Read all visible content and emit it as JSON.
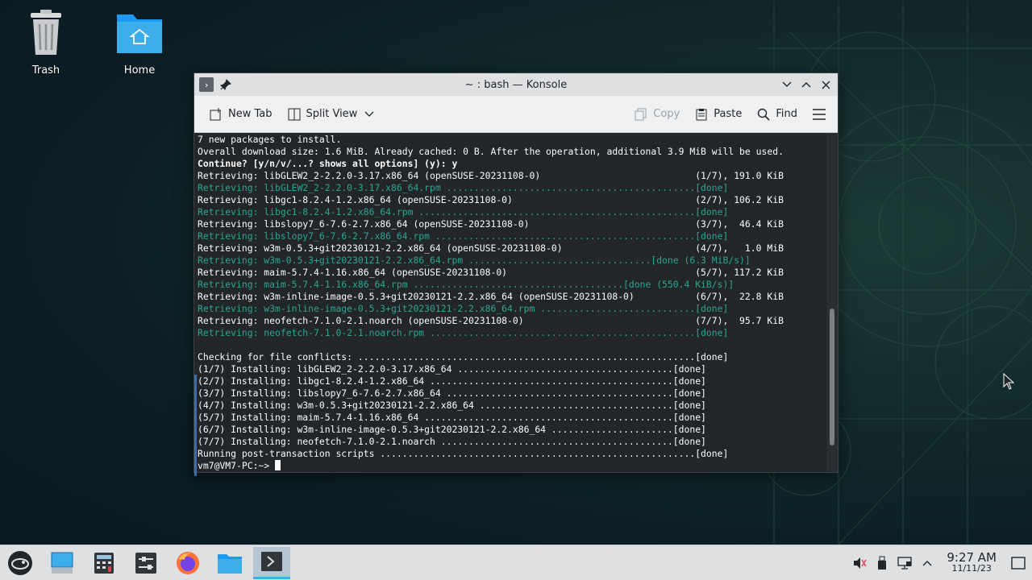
{
  "desktop": {
    "icons": [
      {
        "label": "Trash",
        "icon": "trash-icon"
      },
      {
        "label": "Home",
        "icon": "home-folder-icon"
      }
    ]
  },
  "window": {
    "title": "~ : bash — Konsole",
    "toolbar": {
      "new_tab": "New Tab",
      "split_view": "Split View",
      "copy": "Copy",
      "paste": "Paste",
      "find": "Find"
    }
  },
  "terminal": {
    "lines": [
      {
        "text": "7 new packages to install.",
        "style": "normal"
      },
      {
        "text": "Overall download size: 1.6 MiB. Already cached: 0 B. After the operation, additional 3.9 MiB will be used.",
        "style": "normal"
      },
      {
        "text": "Continue? [y/n/v/...? shows all options] (y): y",
        "style": "bold"
      },
      {
        "text": "Retrieving: libGLEW2_2-2.2.0-3.17.x86_64 (openSUSE-20231108-0)                            (1/7), 191.0 KiB",
        "style": "normal"
      },
      {
        "text": "Retrieving: libGLEW2_2-2.2.0-3.17.x86_64.rpm .............................................[done]",
        "style": "dl"
      },
      {
        "text": "Retrieving: libgc1-8.2.4-1.2.x86_64 (openSUSE-20231108-0)                                 (2/7), 106.2 KiB",
        "style": "normal"
      },
      {
        "text": "Retrieving: libgc1-8.2.4-1.2.x86_64.rpm ..................................................[done]",
        "style": "dl"
      },
      {
        "text": "Retrieving: libslopy7_6-7.6-2.7.x86_64 (openSUSE-20231108-0)                              (3/7),  46.4 KiB",
        "style": "normal"
      },
      {
        "text": "Retrieving: libslopy7_6-7.6-2.7.x86_64.rpm ...............................................[done]",
        "style": "dl"
      },
      {
        "text": "Retrieving: w3m-0.5.3+git20230121-2.2.x86_64 (openSUSE-20231108-0)                        (4/7),   1.0 MiB",
        "style": "normal"
      },
      {
        "text": "Retrieving: w3m-0.5.3+git20230121-2.2.x86_64.rpm .................................[done (6.3 MiB/s)]",
        "style": "dl"
      },
      {
        "text": "Retrieving: maim-5.7.4-1.16.x86_64 (openSUSE-20231108-0)                                  (5/7), 117.2 KiB",
        "style": "normal"
      },
      {
        "text": "Retrieving: maim-5.7.4-1.16.x86_64.rpm ......................................[done (550.4 KiB/s)]",
        "style": "dl"
      },
      {
        "text": "Retrieving: w3m-inline-image-0.5.3+git20230121-2.2.x86_64 (openSUSE-20231108-0)           (6/7),  22.8 KiB",
        "style": "normal"
      },
      {
        "text": "Retrieving: w3m-inline-image-0.5.3+git20230121-2.2.x86_64.rpm ............................[done]",
        "style": "dl"
      },
      {
        "text": "Retrieving: neofetch-7.1.0-2.1.noarch (openSUSE-20231108-0)                               (7/7),  95.7 KiB",
        "style": "normal"
      },
      {
        "text": "Retrieving: neofetch-7.1.0-2.1.noarch.rpm ................................................[done]",
        "style": "dl"
      },
      {
        "text": "",
        "style": "normal"
      },
      {
        "text": "Checking for file conflicts: .............................................................[done]",
        "style": "normal"
      },
      {
        "text": "(1/7) Installing: libGLEW2_2-2.2.0-3.17.x86_64 .......................................[done]",
        "style": "normal"
      },
      {
        "text": "(2/7) Installing: libgc1-8.2.4-1.2.x86_64 ............................................[done]",
        "style": "normal"
      },
      {
        "text": "(3/7) Installing: libslopy7_6-7.6-2.7.x86_64 .........................................[done]",
        "style": "normal"
      },
      {
        "text": "(4/7) Installing: w3m-0.5.3+git20230121-2.2.x86_64 ...................................[done]",
        "style": "normal"
      },
      {
        "text": "(5/7) Installing: maim-5.7.4-1.16.x86_64 .............................................[done]",
        "style": "normal"
      },
      {
        "text": "(6/7) Installing: w3m-inline-image-0.5.3+git20230121-2.2.x86_64 ......................[done]",
        "style": "normal"
      },
      {
        "text": "(7/7) Installing: neofetch-7.1.0-2.1.noarch ..........................................[done]",
        "style": "normal"
      },
      {
        "text": "Running post-transaction scripts .........................................................[done]",
        "style": "normal"
      }
    ],
    "prompt": "vm7@VM7-PC:~> "
  },
  "taskbar": {
    "apps": [
      {
        "name": "app-launcher",
        "icon": "opensuse-icon"
      },
      {
        "name": "desktop-pager",
        "icon": "pager-icon"
      },
      {
        "name": "calculator",
        "icon": "calculator-icon"
      },
      {
        "name": "system-settings",
        "icon": "settings-icon"
      },
      {
        "name": "firefox",
        "icon": "firefox-icon"
      },
      {
        "name": "dolphin",
        "icon": "folder-icon"
      },
      {
        "name": "konsole",
        "icon": "terminal-icon"
      }
    ],
    "clock": {
      "time": "9:27 AM",
      "date": "11/11/23"
    }
  }
}
